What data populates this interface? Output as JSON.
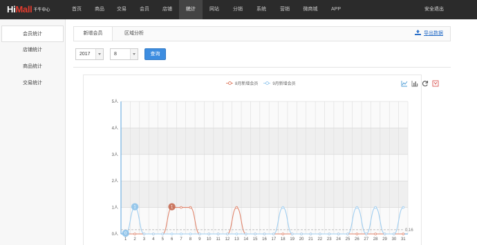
{
  "brand": {
    "logo_main": "Hi",
    "logo_accent": "Mall",
    "logo_sub": "千牛中心"
  },
  "nav": {
    "items": [
      {
        "label": "首页",
        "width": 36
      },
      {
        "label": "商品",
        "width": 30
      },
      {
        "label": "交易",
        "width": 34
      },
      {
        "label": "会员",
        "width": 32
      },
      {
        "label": "店铺",
        "width": 34
      },
      {
        "label": "统计",
        "width": 34,
        "active": true
      },
      {
        "label": "网站",
        "width": 34
      },
      {
        "label": "分销",
        "width": 34
      },
      {
        "label": "系统",
        "width": 34
      },
      {
        "label": "营销",
        "width": 34
      },
      {
        "label": "微商城",
        "width": 40
      },
      {
        "label": "APP",
        "width": 34
      }
    ],
    "logout": "安全退出"
  },
  "sidebar": {
    "items": [
      {
        "label": "会员统计",
        "active": true
      },
      {
        "label": "店铺统计"
      },
      {
        "label": "商品统计"
      },
      {
        "label": "交易统计"
      }
    ]
  },
  "tabs": [
    {
      "label": "新增会员",
      "active": true
    },
    {
      "label": "区域分析"
    }
  ],
  "export": {
    "label": "导出数据",
    "icon": "download-icon"
  },
  "filters": {
    "year": "2017",
    "month": "8",
    "query": "查询"
  },
  "toolbox": [
    "line-chart-icon",
    "bar-chart-icon",
    "refresh-icon",
    "save-icon"
  ],
  "colors": {
    "accent": "#3d8de0",
    "series1": "#e0836a",
    "series2": "#9ecdf0",
    "nav_bg": "#2b2b2b"
  },
  "chart_data": {
    "type": "line",
    "legend": [
      "8月新增会员",
      "9月新增会员"
    ],
    "legend_position": "top-right",
    "x": [
      "1",
      "2",
      "3",
      "4",
      "5",
      "6",
      "7",
      "8",
      "9",
      "10",
      "11",
      "12",
      "13",
      "14",
      "15",
      "16",
      "17",
      "18",
      "19",
      "20",
      "21",
      "22",
      "23",
      "24",
      "25",
      "26",
      "27",
      "28",
      "29",
      "30",
      "31"
    ],
    "y_ticks": [
      "0人",
      "1人",
      "2人",
      "3人",
      "4人",
      "5人"
    ],
    "ylim": [
      0,
      5
    ],
    "series": [
      {
        "name": "8月新增会员",
        "color": "#e0836a",
        "values": [
          0,
          0,
          0,
          0,
          0,
          1,
          1,
          1,
          0,
          0,
          0,
          0,
          1,
          0,
          0,
          0,
          0,
          0,
          0,
          0,
          0,
          0,
          0,
          0,
          0,
          0,
          0,
          0,
          0,
          0,
          0
        ],
        "markpoint": {
          "x": "6",
          "value": "1"
        }
      },
      {
        "name": "9月新增会员",
        "color": "#9ecdf0",
        "values": [
          0,
          1,
          0,
          0,
          0,
          0,
          0,
          0,
          0,
          0,
          0,
          0,
          0,
          0,
          0,
          0,
          0,
          1,
          0,
          0,
          0,
          0,
          0,
          0,
          0,
          1,
          0,
          1,
          0,
          0,
          1
        ],
        "markpoints": [
          {
            "x": "2",
            "value": "1"
          },
          {
            "x": "1",
            "value": "0"
          }
        ]
      }
    ],
    "markline": {
      "value": "0.16",
      "label": "0.16"
    },
    "grid": true
  }
}
